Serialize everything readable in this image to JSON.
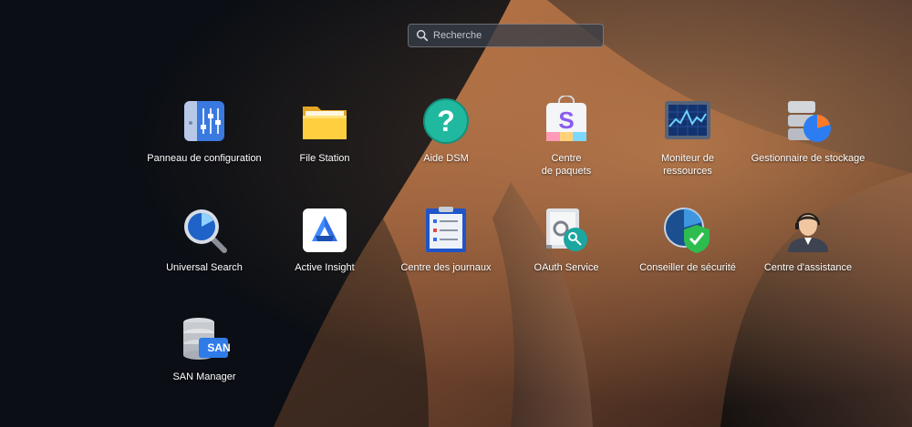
{
  "search": {
    "placeholder": "Recherche",
    "icon": "search-icon"
  },
  "apps": [
    {
      "label": "Panneau de configuration",
      "icon": "control-panel-icon"
    },
    {
      "label": "File Station",
      "icon": "folder-icon"
    },
    {
      "label": "Aide DSM",
      "icon": "help-icon"
    },
    {
      "label": "Centre\nde paquets",
      "icon": "package-center-icon"
    },
    {
      "label": "Moniteur de\nressources",
      "icon": "resource-monitor-icon"
    },
    {
      "label": "Gestionnaire de stockage",
      "icon": "storage-manager-icon"
    },
    {
      "label": "Universal Search",
      "icon": "magnifier-icon"
    },
    {
      "label": "Active Insight",
      "icon": "active-insight-icon"
    },
    {
      "label": "Centre des journaux",
      "icon": "log-center-icon"
    },
    {
      "label": "OAuth Service",
      "icon": "oauth-safe-icon"
    },
    {
      "label": "Conseiller de sécurité",
      "icon": "security-shield-icon"
    },
    {
      "label": "Centre d'assistance",
      "icon": "support-agent-icon"
    },
    {
      "label": "SAN Manager",
      "icon": "san-manager-icon"
    }
  ],
  "san_badge": "SAN",
  "help_glyph": "?",
  "package_glyph": "S"
}
